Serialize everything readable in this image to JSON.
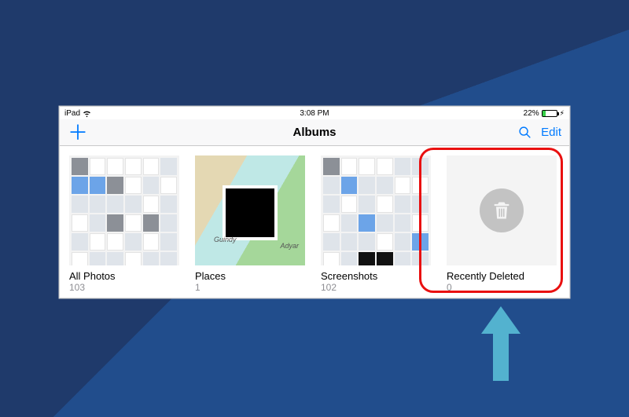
{
  "statusbar": {
    "device": "iPad",
    "time": "3:08 PM",
    "battery_pct": "22%"
  },
  "navbar": {
    "title": "Albums",
    "edit": "Edit"
  },
  "albums": [
    {
      "name": "All Photos",
      "count": "103"
    },
    {
      "name": "Places",
      "count": "1"
    },
    {
      "name": "Screenshots",
      "count": "102"
    },
    {
      "name": "Recently Deleted",
      "count": "0"
    }
  ],
  "map": {
    "label_right": "Adyar",
    "label_left": "Guindy"
  }
}
